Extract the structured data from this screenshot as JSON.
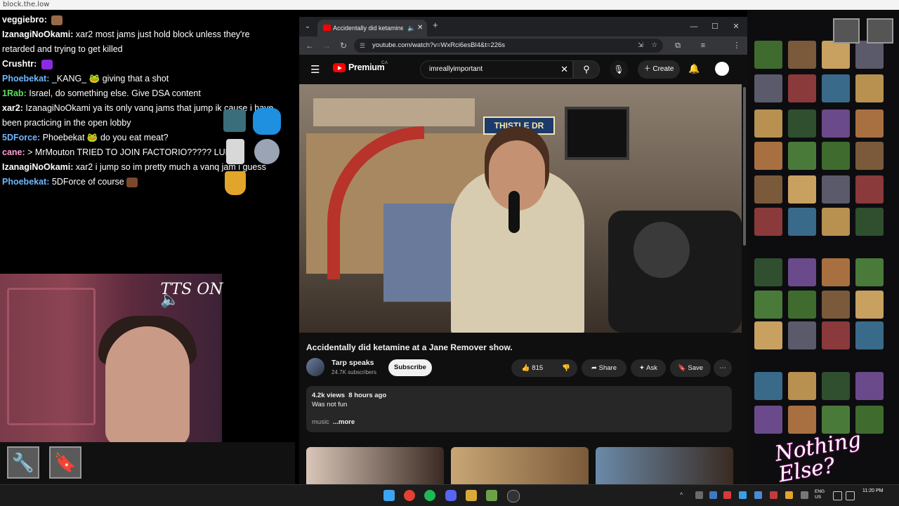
{
  "stream": {
    "top_left_text": "block.the.low",
    "chat": [
      {
        "user": "veggiebro:",
        "color": "#ffffff",
        "text": "",
        "emote": "#9a6a48"
      },
      {
        "user": "IzanagiNoOkami:",
        "color": "#ffffff",
        "text": "xar2 most jams just hold block unless they're retarded and trying to get killed"
      },
      {
        "user": "Crushtr:",
        "color": "#ffffff",
        "text": "",
        "emote": "#8a2be2"
      },
      {
        "user": "Phoebekat:",
        "color": "#6fb8ff",
        "text": "_KANG_ 🐸 giving that a shot"
      },
      {
        "user": "1Rab:",
        "color": "#5be35b",
        "text": "Israel, do something else. Give DSA content"
      },
      {
        "user": "xar2:",
        "color": "#ffffff",
        "text": "IzanagiNoOkami ya its only vanq jams that jump ik cause i have been practicing in the open lobby"
      },
      {
        "user": "5DForce:",
        "color": "#6fb8ff",
        "text": "Phoebekat 🐸 do you eat meat?"
      },
      {
        "user": "cane:",
        "color": "#ff9fd5",
        "text": "> MrMouton TRIED TO JOIN FACTORIO????? LUL"
      },
      {
        "user": "IzanagiNoOkami:",
        "color": "#ffffff",
        "text": "xar2 i jump so im pretty much a vanq jam i guess"
      },
      {
        "user": "Phoebekat:",
        "color": "#6fb8ff",
        "text": "5DForce of course",
        "emote": "#7a4a2a"
      }
    ],
    "tts_label": "TTS ON",
    "overlay_text": "Nothing Else?",
    "tool_icons": [
      "wrench-icon",
      "bookmark-icon"
    ]
  },
  "browser": {
    "tab_title": "Accidentally did ketamine a",
    "url": "youtube.com/watch?v=WxRci6esBl4&t=226s",
    "colors": {
      "tabbar": "#202124",
      "accent": "#ff0000"
    }
  },
  "youtube": {
    "brand": "Premium",
    "country": "CA",
    "search_query": "imreallyimportant",
    "create_label": "Create",
    "video_title": "Accidentally did ketamine at a Jane Remover show.",
    "channel_name": "Tarp speaks",
    "subscribers": "24.7K subscribers",
    "subscribe_label": "Subscribe",
    "likes": "815",
    "share_label": "Share",
    "ask_label": "Ask",
    "save_label": "Save",
    "views": "4.2k views",
    "posted": "8 hours ago",
    "description": "Was not fun",
    "tags": "music",
    "more_label": "...more",
    "video_sign": "THISTLE DR"
  },
  "taskbar": {
    "time": "11:20 PM",
    "locale": "ENG US",
    "apps": [
      "windows-start-icon",
      "chrome-icon",
      "spotify-icon",
      "discord-icon",
      "files-icon",
      "minecraft-icon",
      "obs-icon"
    ]
  }
}
